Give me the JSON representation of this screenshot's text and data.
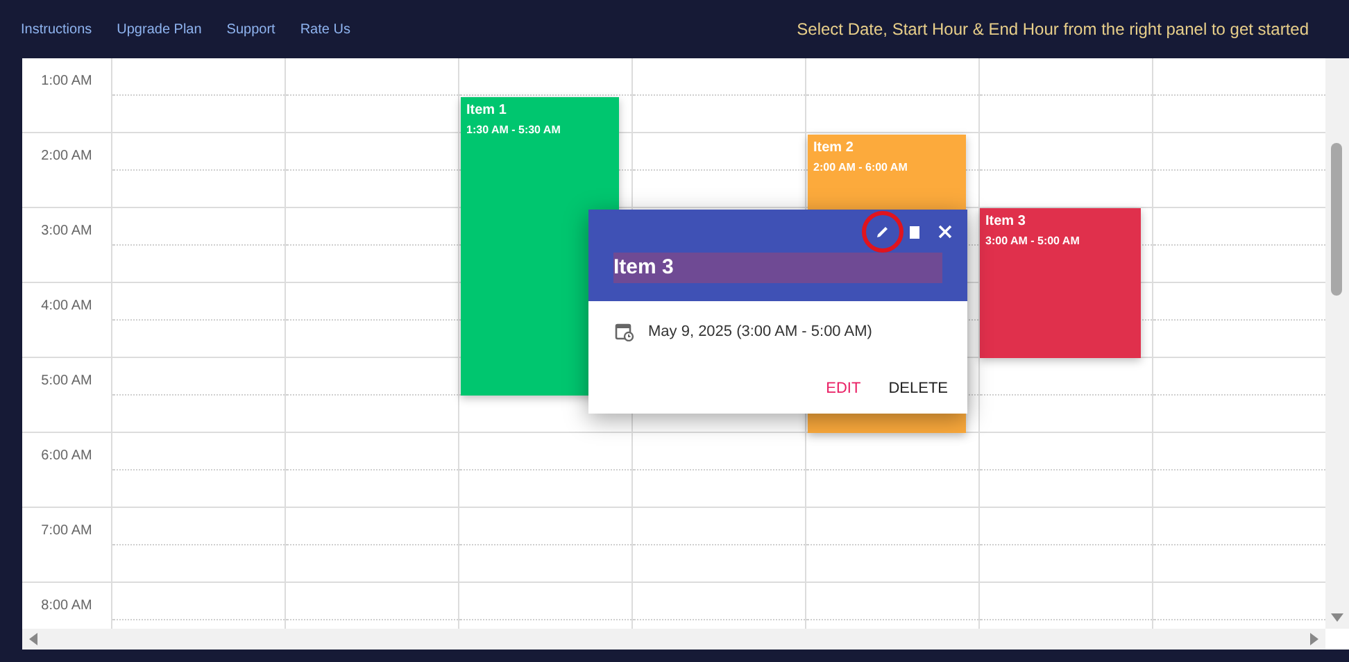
{
  "nav": {
    "links": [
      "Instructions",
      "Upgrade Plan",
      "Support",
      "Rate Us"
    ],
    "notice": "Select Date, Start Hour & End Hour from the right panel to get started"
  },
  "calendar": {
    "time_labels": [
      "1:00 AM",
      "2:00 AM",
      "3:00 AM",
      "4:00 AM",
      "5:00 AM",
      "6:00 AM",
      "7:00 AM",
      "8:00 AM"
    ],
    "events": [
      {
        "title": "Item 1",
        "time": "1:30 AM - 5:30 AM",
        "color": "#00c66f"
      },
      {
        "title": "Item 2",
        "time": "2:00 AM - 6:00 AM",
        "color": "#fcaa3c"
      },
      {
        "title": "Item 3",
        "time": "3:00 AM - 5:00 AM",
        "color": "#e0304c"
      }
    ]
  },
  "popup": {
    "title": "Item 3",
    "date": "May 9, 2025 (3:00 AM - 5:00 AM)",
    "actions": [
      {
        "label": "EDIT",
        "kind": "edit"
      },
      {
        "label": "DELETE",
        "kind": "delete"
      }
    ]
  }
}
